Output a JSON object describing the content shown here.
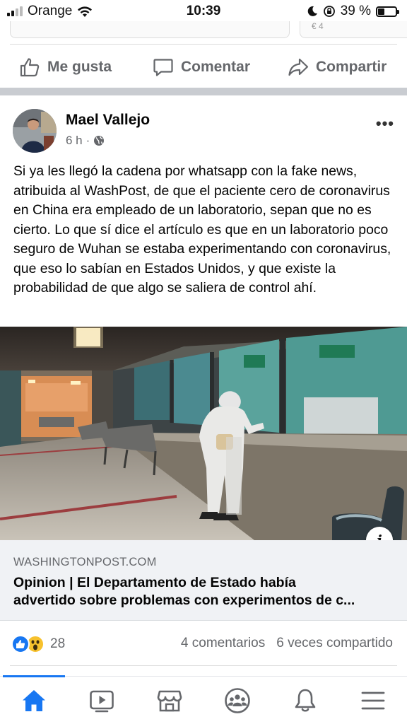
{
  "status_bar": {
    "carrier": "Orange",
    "time": "10:39",
    "battery": "39 %",
    "battery_level": 0.39
  },
  "previous_post": {
    "partial_count": "€ 4"
  },
  "action_bar": {
    "like": "Me gusta",
    "comment": "Comentar",
    "share": "Compartir"
  },
  "post": {
    "author": "Mael Vallejo",
    "time": "6 h",
    "separator": "·",
    "text": "Si ya les llegó la cadena por whatsapp con la fake news, atribuida al WashPost, de que el paciente cero de coronavirus en China era empleado de un laboratorio, sepan que no es cierto. Lo que sí dice el artículo es que en un laboratorio poco seguro de Wuhan se estaba experimentando con coronavirus, que eso lo sabían en Estados Unidos, y que existe la probabilidad de que algo se saliera de control ahí.",
    "link": {
      "domain": "WASHINGTONPOST.COM",
      "title_line1": "Opinion | El Departamento de Estado había",
      "title_line2": "advertido sobre problemas con experimentos de c..."
    },
    "reactions_count": "28",
    "comments": "4 comentarios",
    "shares": "6 veces compartido"
  },
  "icons": {
    "like": "thumbs-up-icon",
    "comment": "speech-bubble-icon",
    "share": "share-arrow-icon",
    "privacy": "globe-icon",
    "more": "more-dots-icon",
    "info": "info-icon"
  },
  "nav": [
    "home-icon",
    "watch-icon",
    "marketplace-icon",
    "groups-icon",
    "notifications-icon",
    "menu-icon"
  ],
  "colors": {
    "accent": "#1877f2",
    "secondary_text": "#65676b",
    "link_box_bg": "#f0f2f5",
    "separator": "#c9ccd1"
  }
}
